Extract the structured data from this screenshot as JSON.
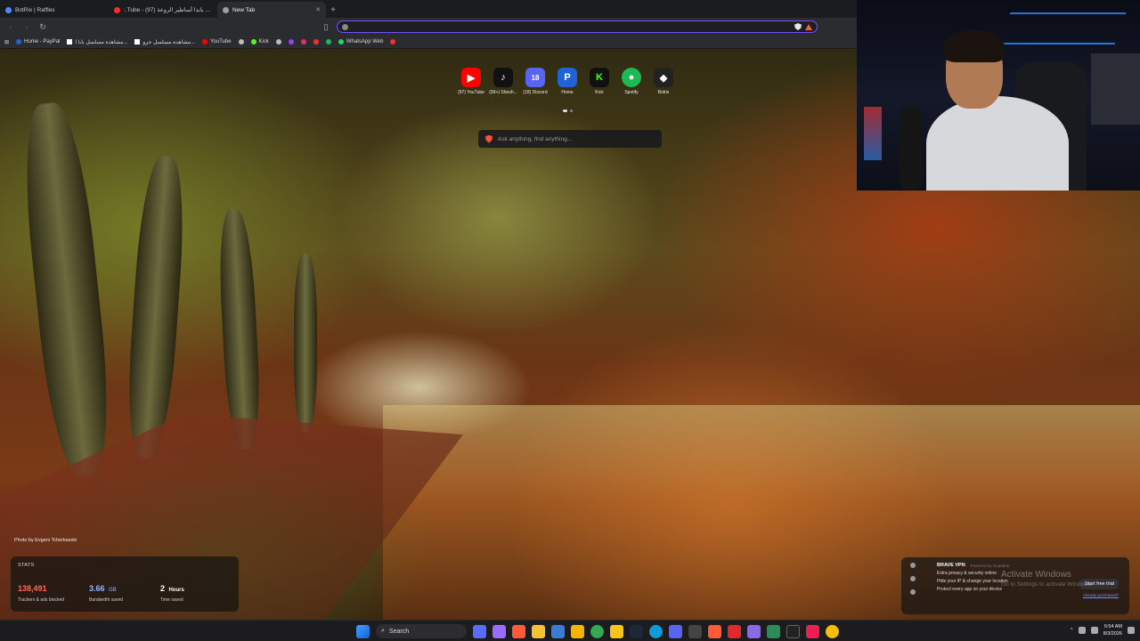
{
  "tabs": [
    {
      "title": "BotRix | Raffles",
      "color": "#4a8cff",
      "active": false
    },
    {
      "title": ":.Tube - كونفو باندا أساطير الروعة (97)",
      "color": "#ff2b2b",
      "active": false
    },
    {
      "title": "New Tab",
      "color": "#9aa0a6",
      "active": true
    }
  ],
  "omnibox": {
    "value": ""
  },
  "bookmarks": [
    {
      "label": "Home - PayPal",
      "color": "#1e64d6",
      "icon": "paypal-icon"
    },
    {
      "label": "مشاهدة مسلسل بابا ا...",
      "color": "#ffffff",
      "icon": "page-icon"
    },
    {
      "label": "مشاهدة مسلسل جرو...",
      "color": "#ffffff",
      "icon": "page-icon"
    },
    {
      "label": "YouTube",
      "color": "#ff0000",
      "icon": "youtube-icon"
    },
    {
      "label": "",
      "color": "#bbbbbb",
      "icon": "globe-icon"
    },
    {
      "label": "Kick",
      "color": "#53fc18",
      "icon": "kick-icon"
    },
    {
      "label": "",
      "color": "#bbbbbb",
      "icon": "globe-icon"
    },
    {
      "label": "",
      "color": "#8c44f7",
      "icon": "twitch-icon"
    },
    {
      "label": "",
      "color": "#e1306c",
      "icon": "instagram-icon"
    },
    {
      "label": "",
      "color": "#ff2b2b",
      "icon": "youtube-icon"
    },
    {
      "label": "",
      "color": "#1db954",
      "icon": "spotify-icon"
    },
    {
      "label": "WhatsApp Web",
      "color": "#25d366",
      "icon": "whatsapp-icon"
    },
    {
      "label": "",
      "color": "#ff2b2b",
      "icon": "netflix-icon"
    }
  ],
  "speed_dial": [
    {
      "label": "(97) YouTube",
      "glyph": "▶",
      "bg": "#ff0000",
      "icon": "youtube-icon"
    },
    {
      "label": "(99+) Shesh...",
      "glyph": "♪",
      "bg": "#111111",
      "icon": "tiktok-icon"
    },
    {
      "label": "(18) Discord",
      "glyph": "18",
      "bg": "#5865f2",
      "icon": "discord-icon"
    },
    {
      "label": "Home",
      "glyph": "P",
      "bg": "#1e64d6",
      "icon": "paypal-icon"
    },
    {
      "label": "Kick",
      "glyph": "K",
      "bg": "#111111",
      "icon": "kick-icon"
    },
    {
      "label": "Spotify",
      "glyph": "●",
      "bg": "#1db954",
      "icon": "spotify-icon"
    },
    {
      "label": "Botrix",
      "glyph": "◆",
      "bg": "#222222",
      "icon": "botrix-icon"
    }
  ],
  "leo": {
    "placeholder": "Ask anything, find anything..."
  },
  "photo_credit": "Photo by Evgeni Tcherkasski",
  "stats": {
    "title": "STATS",
    "trackers": {
      "value": "138,491",
      "label": "Trackers & ads blocked"
    },
    "bandwidth": {
      "value": "3.66",
      "unit": "GB",
      "label": "Bandwidth saved"
    },
    "time": {
      "value": "2",
      "unit": "Hours",
      "label": "Time saved"
    }
  },
  "vpn": {
    "title": "BRAVE VPN",
    "powered": "Powered by Guardian",
    "lines": [
      "Extra privacy & security online",
      "Hide your IP & change your location",
      "Protect every app on your device"
    ],
    "trial_button": "Start free trial",
    "purchased_link": "Already purchased?"
  },
  "activation": {
    "title": "Activate Windows",
    "subtitle": "Go to Settings to activate Windows."
  },
  "taskbar": {
    "search_label": "Search",
    "time": "6:54 AM",
    "date": "8/3/2026",
    "apps": [
      {
        "name": "widgets-icon",
        "color": "#5a6cff"
      },
      {
        "name": "copilot-icon",
        "color": "#9a6cff"
      },
      {
        "name": "brave-icon",
        "color": "#ff5a36"
      },
      {
        "name": "files-icon",
        "color": "#f4c430"
      },
      {
        "name": "store-icon",
        "color": "#3a7bd5"
      },
      {
        "name": "explorer-icon",
        "color": "#f4b400"
      },
      {
        "name": "chrome-icon",
        "color": "#34a853"
      },
      {
        "name": "app-icon",
        "color": "#f5c518"
      },
      {
        "name": "steam-icon",
        "color": "#1b2838"
      },
      {
        "name": "edge-icon",
        "color": "#0f9bd7"
      },
      {
        "name": "discord-icon",
        "color": "#5865f2"
      },
      {
        "name": "app2-icon",
        "color": "#444444"
      },
      {
        "name": "brave-icon-2",
        "color": "#ff5a36"
      },
      {
        "name": "acrobat-icon",
        "color": "#e0282d"
      },
      {
        "name": "app3-icon",
        "color": "#8a6ae8"
      },
      {
        "name": "app4-icon",
        "color": "#2e8b57"
      },
      {
        "name": "capcut-icon",
        "color": "#222222"
      },
      {
        "name": "tiktok-icon",
        "color": "#ee1d52"
      },
      {
        "name": "chrome-icon-2",
        "color": "#fbbc05"
      }
    ]
  }
}
